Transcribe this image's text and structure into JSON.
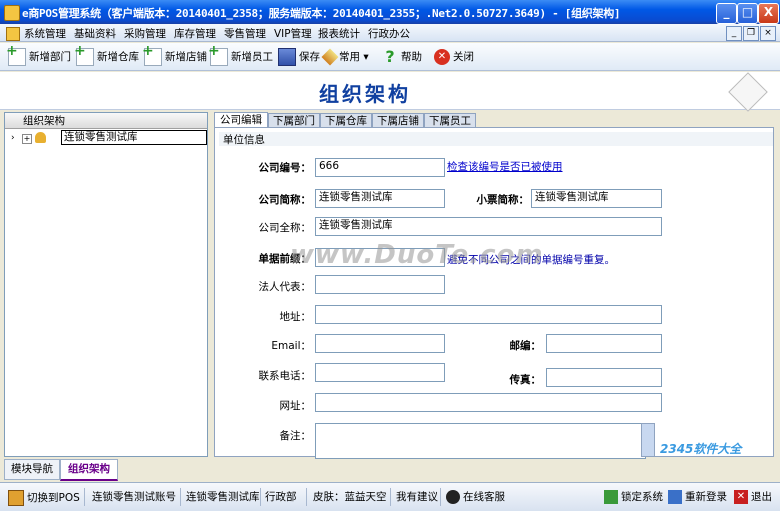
{
  "window": {
    "title": "e商POS管理系统（客户端版本：20140401_2358；服务端版本：20140401_2355；.Net2.0.50727.3649) - [组织架构]",
    "min": "_",
    "max": "□",
    "close": "X"
  },
  "menu": [
    "系统管理",
    "基础资料",
    "采购管理",
    "库存管理",
    "零售管理",
    "VIP管理",
    "报表统计",
    "行政办公"
  ],
  "mdi_buttons": [
    "_",
    "❐",
    "×"
  ],
  "toolbar": {
    "add_dept": "新增部门",
    "add_warehouse": "新增仓库",
    "add_store": "新增店铺",
    "add_employee": "新增员工",
    "save": "保存",
    "common": "常用",
    "help": "帮助",
    "close": "关闭"
  },
  "banner": {
    "title": "组织架构"
  },
  "tree": {
    "header": "组织架构",
    "node": "连锁零售测试库"
  },
  "bottom_tabs": [
    "模块导航",
    "组织架构"
  ],
  "tabs": [
    "公司编辑",
    "下属部门",
    "下属仓库",
    "下属店铺",
    "下属员工"
  ],
  "form": {
    "group": "单位信息",
    "company_code_label": "公司编号：",
    "company_code": "666",
    "check_link": "检查该编号是否已被使用",
    "short_name_label": "公司简称：",
    "short_name": "连锁零售测试库",
    "receipt_name_label": "小票简称：",
    "receipt_name": "连锁零售测试库",
    "full_name_label": "公司全称：",
    "full_name": "连锁零售测试库",
    "doc_prefix_label": "单据前缀：",
    "doc_prefix_note": "避免不同公司之间的单据编号重复。",
    "legal_rep_label": "法人代表：",
    "address_label": "地址：",
    "email_label": "Email：",
    "zip_label": "邮编：",
    "phone_label": "联系电话：",
    "fax_label": "传真：",
    "website_label": "网址：",
    "remark_label": "备注："
  },
  "status": {
    "switch_pos": "切换到POS",
    "account": "连锁零售测试账号",
    "company": "连锁零售测试库",
    "dept": "行政部",
    "skin": "皮肤：蓝益天空",
    "suggest": "我有建议",
    "support": "在线客服",
    "lock": "锁定系统",
    "relogin": "重新登录",
    "exit": "退出"
  },
  "watermark": "www.DuoTe.com",
  "watermark2": "2345软件大全",
  "colors": {
    "title_bar": "#0A4BD0",
    "banner_text": "#1040A0",
    "link": "#0000CC"
  }
}
